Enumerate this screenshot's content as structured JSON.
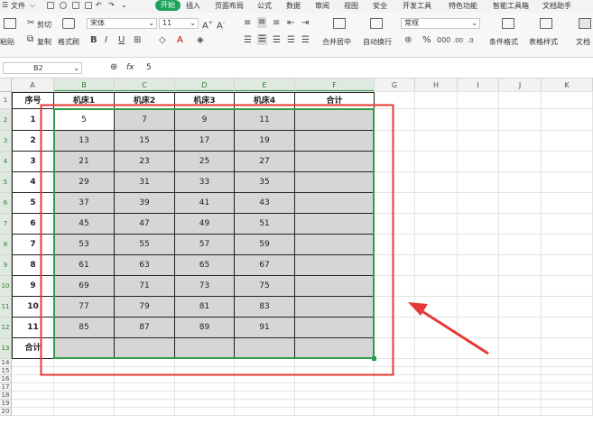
{
  "menubar": {
    "file_label": "文件",
    "tabs": [
      "开始",
      "插入",
      "页面布局",
      "公式",
      "数据",
      "审阅",
      "视图",
      "安全",
      "开发工具",
      "特色功能",
      "智能工具箱",
      "文档助手"
    ]
  },
  "ribbon": {
    "paste_label": "粘贴",
    "cut_label": "剪切",
    "copy_label": "复制",
    "format_painter_label": "格式刷",
    "font_name": "宋体",
    "font_size": "11",
    "merge_center_label": "合并居中",
    "wrap_text_label": "自动换行",
    "number_format": "常规",
    "conditional_format_label": "条件格式",
    "table_style_label": "表格样式",
    "doc_label": "文档"
  },
  "formula_bar": {
    "cell_ref": "B2",
    "fx_label": "fx",
    "value": "5"
  },
  "sheet": {
    "columns": [
      "A",
      "B",
      "C",
      "D",
      "E",
      "F",
      "G",
      "H",
      "I",
      "J",
      "K"
    ],
    "row_numbers": [
      "1",
      "2",
      "3",
      "4",
      "5",
      "6",
      "7",
      "8",
      "9",
      "10",
      "11",
      "12",
      "13",
      "14",
      "15",
      "16",
      "17",
      "18",
      "19",
      "20"
    ],
    "headers": [
      "序号",
      "机床1",
      "机床2",
      "机床3",
      "机床4",
      "合计"
    ],
    "rows": [
      [
        "1",
        "5",
        "7",
        "9",
        "11",
        ""
      ],
      [
        "2",
        "13",
        "15",
        "17",
        "19",
        ""
      ],
      [
        "3",
        "21",
        "23",
        "25",
        "27",
        ""
      ],
      [
        "4",
        "29",
        "31",
        "33",
        "35",
        ""
      ],
      [
        "5",
        "37",
        "39",
        "41",
        "43",
        ""
      ],
      [
        "6",
        "45",
        "47",
        "49",
        "51",
        ""
      ],
      [
        "7",
        "53",
        "55",
        "57",
        "59",
        ""
      ],
      [
        "8",
        "61",
        "63",
        "65",
        "67",
        ""
      ],
      [
        "9",
        "69",
        "71",
        "73",
        "75",
        ""
      ],
      [
        "10",
        "77",
        "79",
        "81",
        "83",
        ""
      ],
      [
        "11",
        "85",
        "87",
        "89",
        "91",
        ""
      ],
      [
        "合计",
        "",
        "",
        "",
        "",
        ""
      ]
    ]
  },
  "colors": {
    "accent_green": "#1ca35a",
    "selection_green": "#2e9e47",
    "selection_fill": "#d6d6d6",
    "annotation_red": "#e53935"
  }
}
